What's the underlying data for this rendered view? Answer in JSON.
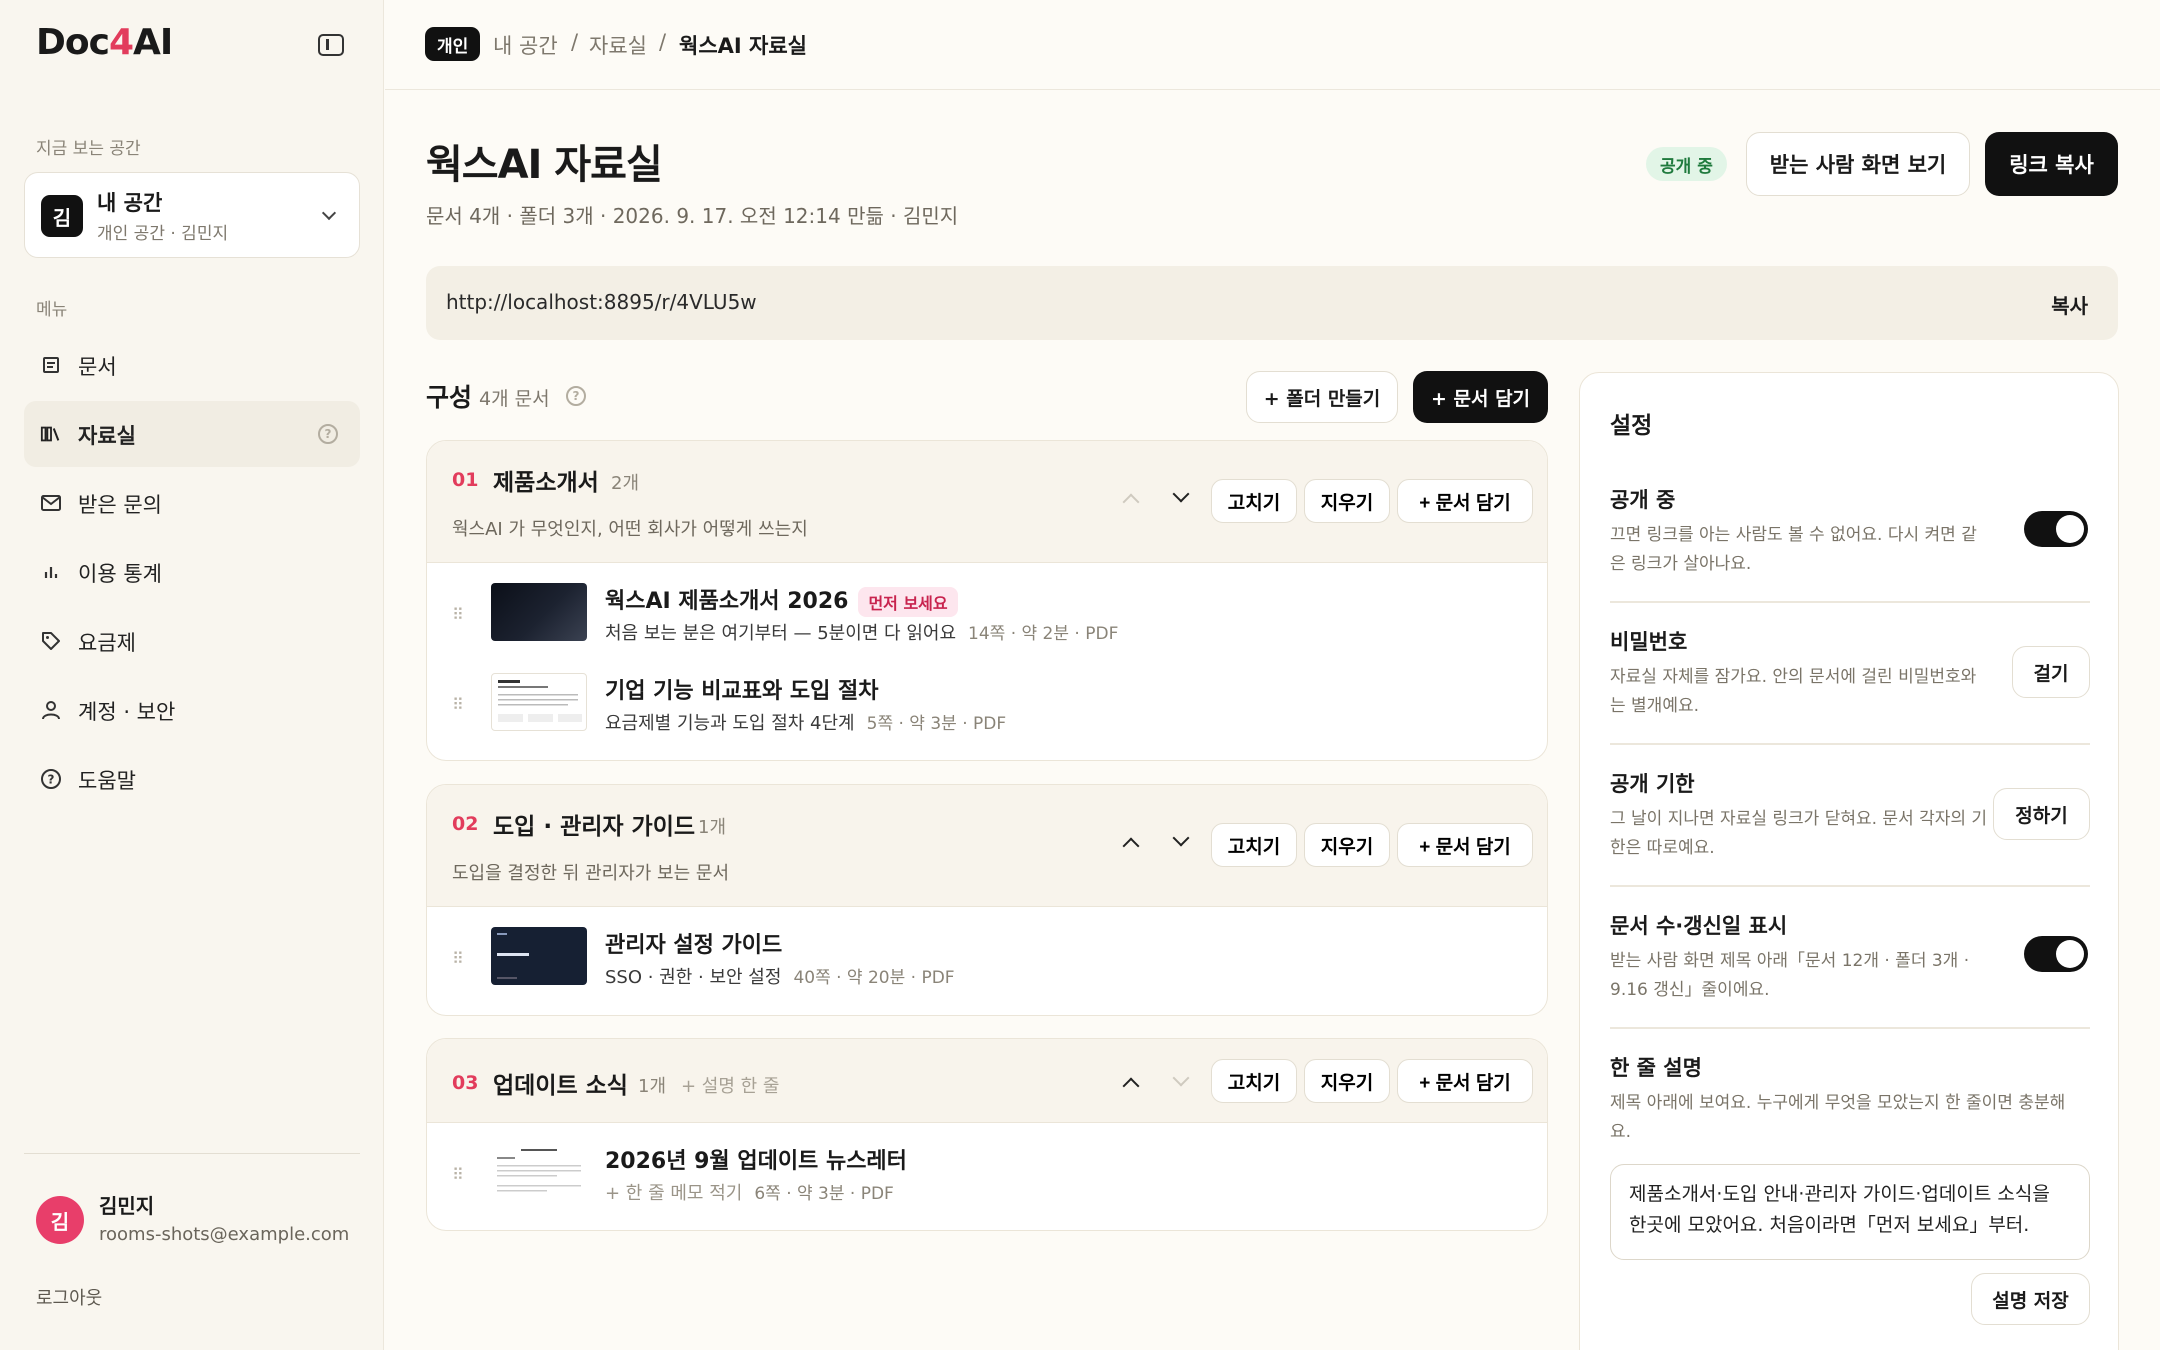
{
  "app": {
    "logo_pre": "Doc",
    "logo_num": "4",
    "logo_post": "AI"
  },
  "sidebar": {
    "current_space_label": "지금 보는 공간",
    "space": {
      "avatar": "김",
      "name": "내 공간",
      "sub": "개인 공간 · 김민지"
    },
    "menu_label": "메뉴",
    "items": [
      {
        "label": "문서",
        "icon": "document-icon"
      },
      {
        "label": "자료실",
        "icon": "library-icon",
        "active": true
      },
      {
        "label": "받은 문의",
        "icon": "mail-icon"
      },
      {
        "label": "이용 통계",
        "icon": "chart-icon"
      },
      {
        "label": "요금제",
        "icon": "tag-icon"
      },
      {
        "label": "계정 · 보안",
        "icon": "user-icon"
      },
      {
        "label": "도움말",
        "icon": "help-icon"
      }
    ],
    "user": {
      "avatar": "김",
      "name": "김민지",
      "email": "rooms-shots@example.com"
    },
    "logout": "로그아웃"
  },
  "breadcrumb": {
    "badge": "개인",
    "items": [
      "내 공간",
      "자료실",
      "웍스AI 자료실"
    ],
    "sep": "/"
  },
  "header": {
    "title": "웍스AI 자료실",
    "meta": "문서 4개 · 폴더 3개 · 2026. 9. 17. 오전 12:14 만듦 · 김민지",
    "status": "공개 중",
    "preview_button": "받는 사람 화면 보기",
    "copy_link_button": "링크 복사"
  },
  "url_bar": {
    "url": "http://localhost:8895/r/4VLU5w",
    "copy": "복사"
  },
  "composition": {
    "title": "구성",
    "count": "4개 문서",
    "new_folder": "+ 폴더 만들기",
    "add_doc": "+ 문서 담기",
    "folder_actions": {
      "edit": "고치기",
      "delete": "지우기",
      "add": "+ 문서 담기"
    },
    "folders": [
      {
        "num": "01",
        "name": "제품소개서",
        "count": "2개",
        "desc": "웍스AI 가 무엇인지, 어떤 회사가 어떻게 쓰는지",
        "docs": [
          {
            "title": "웍스AI 제품소개서 2026",
            "badge": "먼저 보세요",
            "sub": "처음 보는 분은 여기부터 — 5분이면 다 읽어요",
            "meta": "14쪽 · 약 2분 · PDF"
          },
          {
            "title": "기업 기능 비교표와 도입 절차",
            "sub": "요금제별 기능과 도입 절차 4단계",
            "meta": "5쪽 · 약 3분 · PDF"
          }
        ]
      },
      {
        "num": "02",
        "name": "도입 · 관리자 가이드",
        "count": "1개",
        "desc": "도입을 결정한 뒤 관리자가 보는 문서",
        "docs": [
          {
            "title": "관리자 설정 가이드",
            "sub": "SSO · 권한 · 보안 설정",
            "meta": "40쪽 · 약 20분 · PDF"
          }
        ]
      },
      {
        "num": "03",
        "name": "업데이트 소식",
        "count": "1개",
        "add_desc": "+ 설명 한 줄",
        "docs": [
          {
            "title": "2026년 9월 업데이트 뉴스레터",
            "sub": "+ 한 줄 메모 적기",
            "meta": "6쪽 · 약 3분 · PDF"
          }
        ]
      }
    ]
  },
  "settings": {
    "title": "설정",
    "public": {
      "title": "공개 중",
      "desc": "끄면 링크를 아는 사람도 볼 수 없어요. 다시 켜면 같은 링크가 살아나요.",
      "on": true
    },
    "password": {
      "title": "비밀번호",
      "desc": "자료실 자체를 잠가요. 안의 문서에 걸린 비밀번호와는 별개예요.",
      "button": "걸기"
    },
    "expiry": {
      "title": "공개 기한",
      "desc": "그 날이 지나면 자료실 링크가 닫혀요. 문서 각자의 기한은 따로예요.",
      "button": "정하기"
    },
    "show_counts": {
      "title": "문서 수·갱신일 표시",
      "desc": "받는 사람 화면 제목 아래「문서 12개 · 폴더 3개 · 9.16 갱신」줄이에요.",
      "on": true
    },
    "one_line": {
      "title": "한 줄 설명",
      "desc": "제목 아래에 보여요. 누구에게 무엇을 모았는지 한 줄이면 충분해요.",
      "value": "제품소개서·도입 안내·관리자 가이드·업데이트 소식을 한곳에 모았어요. 처음이라면「먼저 보세요」부터.",
      "save": "설명 저장"
    }
  }
}
